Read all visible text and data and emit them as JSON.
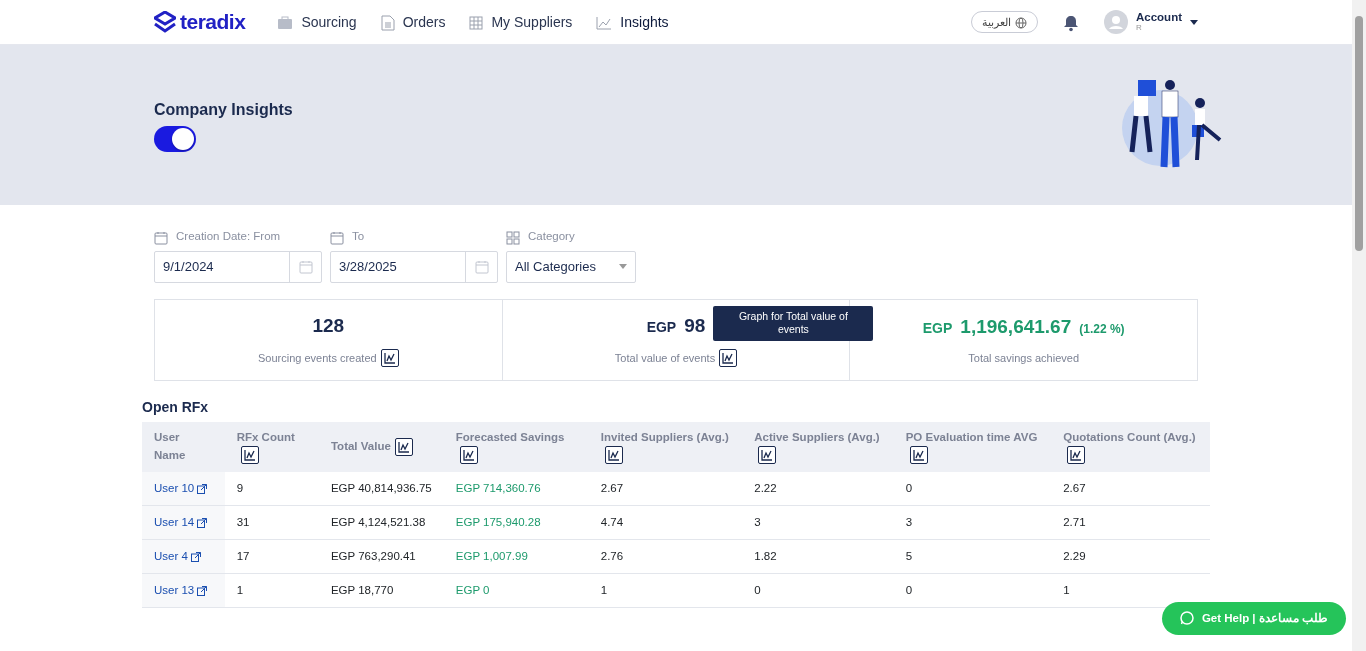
{
  "navbar": {
    "brand": "teradix",
    "links": [
      {
        "kind": "briefcase",
        "label": "Sourcing",
        "selected": false
      },
      {
        "kind": "document",
        "label": "Orders",
        "selected": false
      },
      {
        "kind": "grid",
        "label": "My Suppliers",
        "selected": false
      },
      {
        "kind": "chart",
        "label": "Insights",
        "selected": true
      }
    ],
    "language": "العربية",
    "account": {
      "label": "Account",
      "initial": "R"
    }
  },
  "banner": {
    "title": "Company Insights",
    "toggle_on": true
  },
  "filters": [
    {
      "kind": "date",
      "label": "Creation Date: From",
      "value": "9/1/2024"
    },
    {
      "kind": "date",
      "label": "To",
      "value": "3/28/2025"
    },
    {
      "kind": "select",
      "label": "Category",
      "value": "All Categories"
    }
  ],
  "stats": [
    {
      "kind": "count",
      "value": "128",
      "caption": "Sourcing events created",
      "graph_button": true
    },
    {
      "kind": "money",
      "currency": "EGP",
      "value": "98",
      "caption": "Total value of events",
      "graph_button": true,
      "tooltip": "Graph for Total value of events"
    },
    {
      "kind": "savings",
      "currency": "EGP",
      "value": "1,196,641.67",
      "percent": "(1.22 %)",
      "caption": "Total savings achieved",
      "graph_button": false
    }
  ],
  "table": {
    "title": "Open RFx",
    "columns": [
      {
        "label": "User Name",
        "graph_button": false
      },
      {
        "label": "RFx Count",
        "graph_button": true
      },
      {
        "label": "Total Value",
        "graph_button": true
      },
      {
        "label": "Forecasted Savings",
        "graph_button": true
      },
      {
        "label": "Invited Suppliers (Avg.)",
        "graph_button": true
      },
      {
        "label": "Active Suppliers (Avg.)",
        "graph_button": true
      },
      {
        "label": "PO Evaluation time AVG",
        "graph_button": true
      },
      {
        "label": "Quotations Count (Avg.)",
        "graph_button": true
      }
    ],
    "rows": [
      {
        "cells": [
          "User 10",
          "9",
          "EGP 40,814,936.75",
          "EGP 714,360.76",
          "2.67",
          "2.22",
          "0",
          "2.67"
        ]
      },
      {
        "cells": [
          "User 14",
          "31",
          "EGP 4,124,521.38",
          "EGP 175,940.28",
          "4.74",
          "3",
          "3",
          "2.71"
        ]
      },
      {
        "cells": [
          "User 4",
          "17",
          "EGP 763,290.41",
          "EGP 1,007.99",
          "2.76",
          "1.82",
          "5",
          "2.29"
        ]
      },
      {
        "cells": [
          "User 13",
          "1",
          "EGP 18,770",
          "EGP 0",
          "1",
          "0",
          "0",
          "1"
        ]
      }
    ]
  },
  "help_button": "Get Help | طلب مساعدة"
}
